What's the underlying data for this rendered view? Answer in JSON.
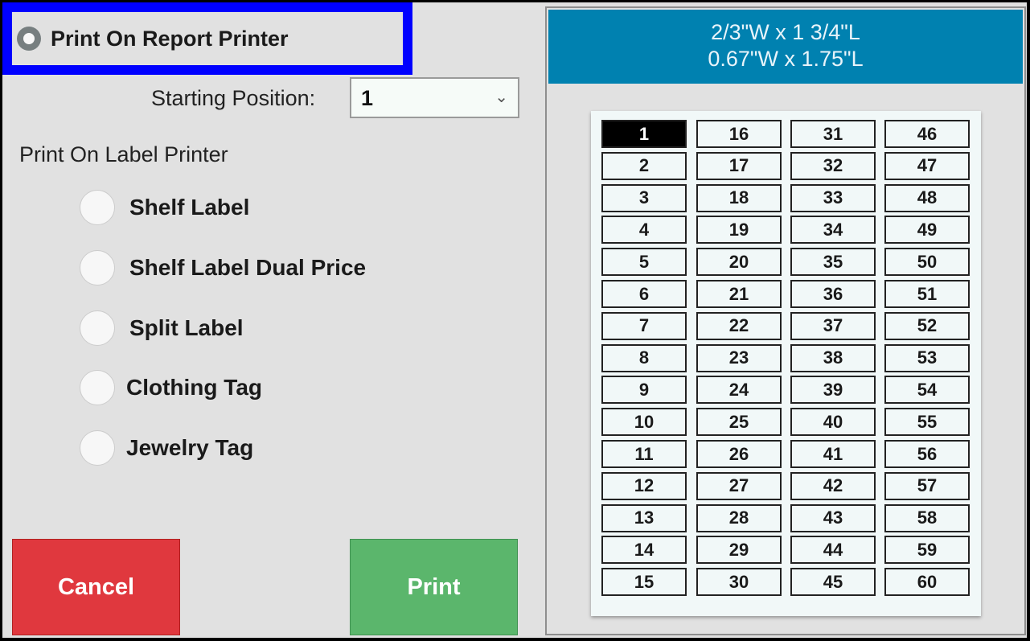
{
  "report_printer": {
    "label": "Print On Report Printer",
    "selected": true
  },
  "starting_position": {
    "label": "Starting Position:",
    "value": "1"
  },
  "label_printer": {
    "heading": "Print On Label Printer",
    "options": [
      {
        "label": "Shelf Label"
      },
      {
        "label": "Shelf Label Dual Price"
      },
      {
        "label": "Split Label"
      },
      {
        "label": "Clothing Tag"
      },
      {
        "label": "Jewelry Tag"
      }
    ]
  },
  "buttons": {
    "cancel": "Cancel",
    "print": "Print"
  },
  "label_sheet": {
    "size_fraction": "2/3\"W x 1 3/4\"L",
    "size_decimal": "0.67\"W x 1.75\"L",
    "selected_position": 1,
    "columns": [
      [
        1,
        2,
        3,
        4,
        5,
        6,
        7,
        8,
        9,
        10,
        11,
        12,
        13,
        14,
        15
      ],
      [
        16,
        17,
        18,
        19,
        20,
        21,
        22,
        23,
        24,
        25,
        26,
        27,
        28,
        29,
        30
      ],
      [
        31,
        32,
        33,
        34,
        35,
        36,
        37,
        38,
        39,
        40,
        41,
        42,
        43,
        44,
        45
      ],
      [
        46,
        47,
        48,
        49,
        50,
        51,
        52,
        53,
        54,
        55,
        56,
        57,
        58,
        59,
        60
      ]
    ]
  },
  "colors": {
    "header": "#0081b0",
    "cancel": "#e0383e",
    "print": "#5bb66c",
    "highlight": "#0000ff"
  }
}
